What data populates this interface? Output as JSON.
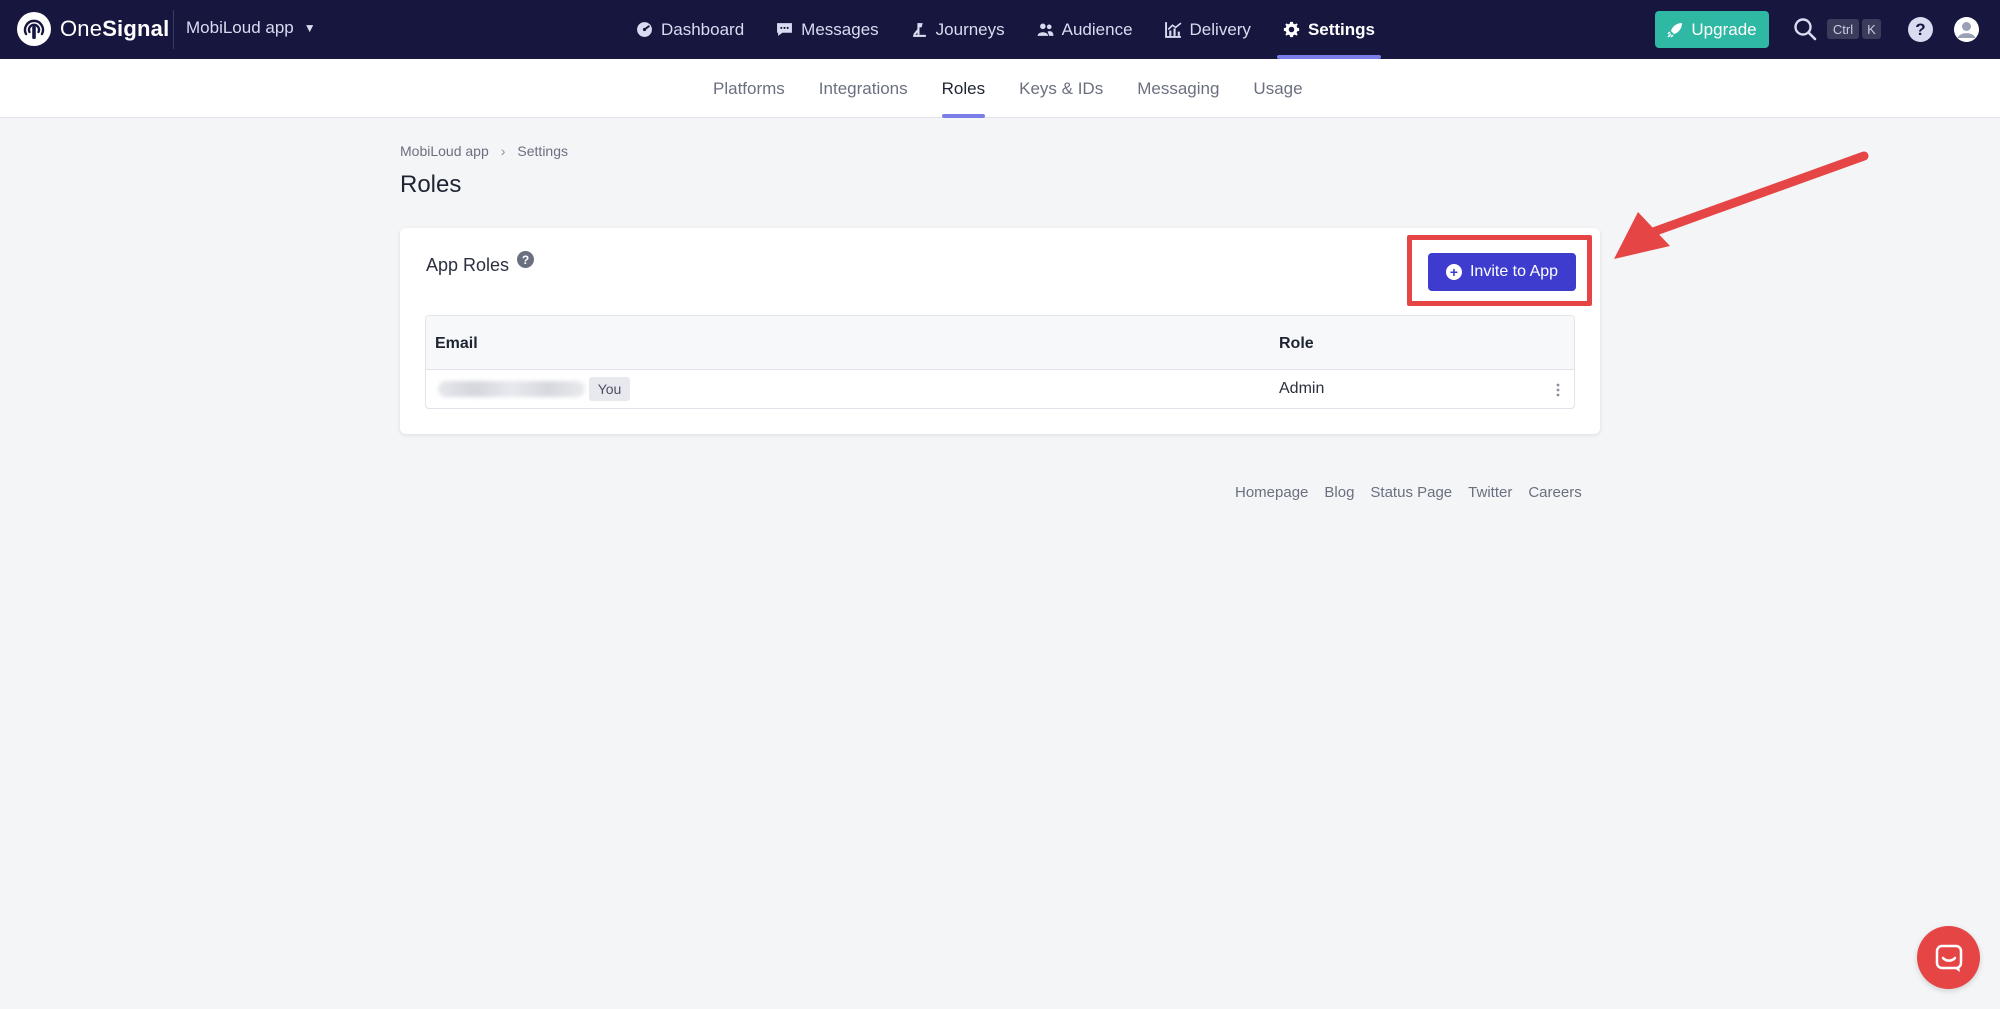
{
  "brand": {
    "name_light": "One",
    "name_bold": "Signal"
  },
  "app_switcher": {
    "label": "MobiLoud app"
  },
  "main_nav": [
    {
      "label": "Dashboard",
      "icon": "dashboard-icon"
    },
    {
      "label": "Messages",
      "icon": "messages-icon"
    },
    {
      "label": "Journeys",
      "icon": "journeys-icon"
    },
    {
      "label": "Audience",
      "icon": "audience-icon"
    },
    {
      "label": "Delivery",
      "icon": "delivery-icon"
    },
    {
      "label": "Settings",
      "icon": "gear-icon",
      "active": true
    }
  ],
  "header": {
    "upgrade_label": "Upgrade",
    "shortcut_ctrl": "Ctrl",
    "shortcut_k": "K",
    "help_label": "?"
  },
  "sub_nav": [
    {
      "label": "Platforms"
    },
    {
      "label": "Integrations"
    },
    {
      "label": "Roles",
      "active": true
    },
    {
      "label": "Keys & IDs"
    },
    {
      "label": "Messaging"
    },
    {
      "label": "Usage"
    }
  ],
  "breadcrumb": {
    "app": "MobiLoud app",
    "separator": "›",
    "section": "Settings"
  },
  "page": {
    "title": "Roles"
  },
  "card": {
    "title": "App Roles",
    "help_glyph": "?",
    "invite_label": "Invite to App",
    "table": {
      "headers": {
        "email": "Email",
        "role": "Role"
      },
      "rows": [
        {
          "email_badge": "You",
          "role": "Admin"
        }
      ]
    }
  },
  "footer": {
    "links": [
      "Homepage",
      "Blog",
      "Status Page",
      "Twitter",
      "Careers"
    ]
  },
  "colors": {
    "nav_bg": "#16163f",
    "accent": "#7a7fe8",
    "upgrade": "#2fb8a3",
    "primary_button": "#3d3ccf",
    "highlight": "#e64545",
    "chat": "#e64545"
  }
}
